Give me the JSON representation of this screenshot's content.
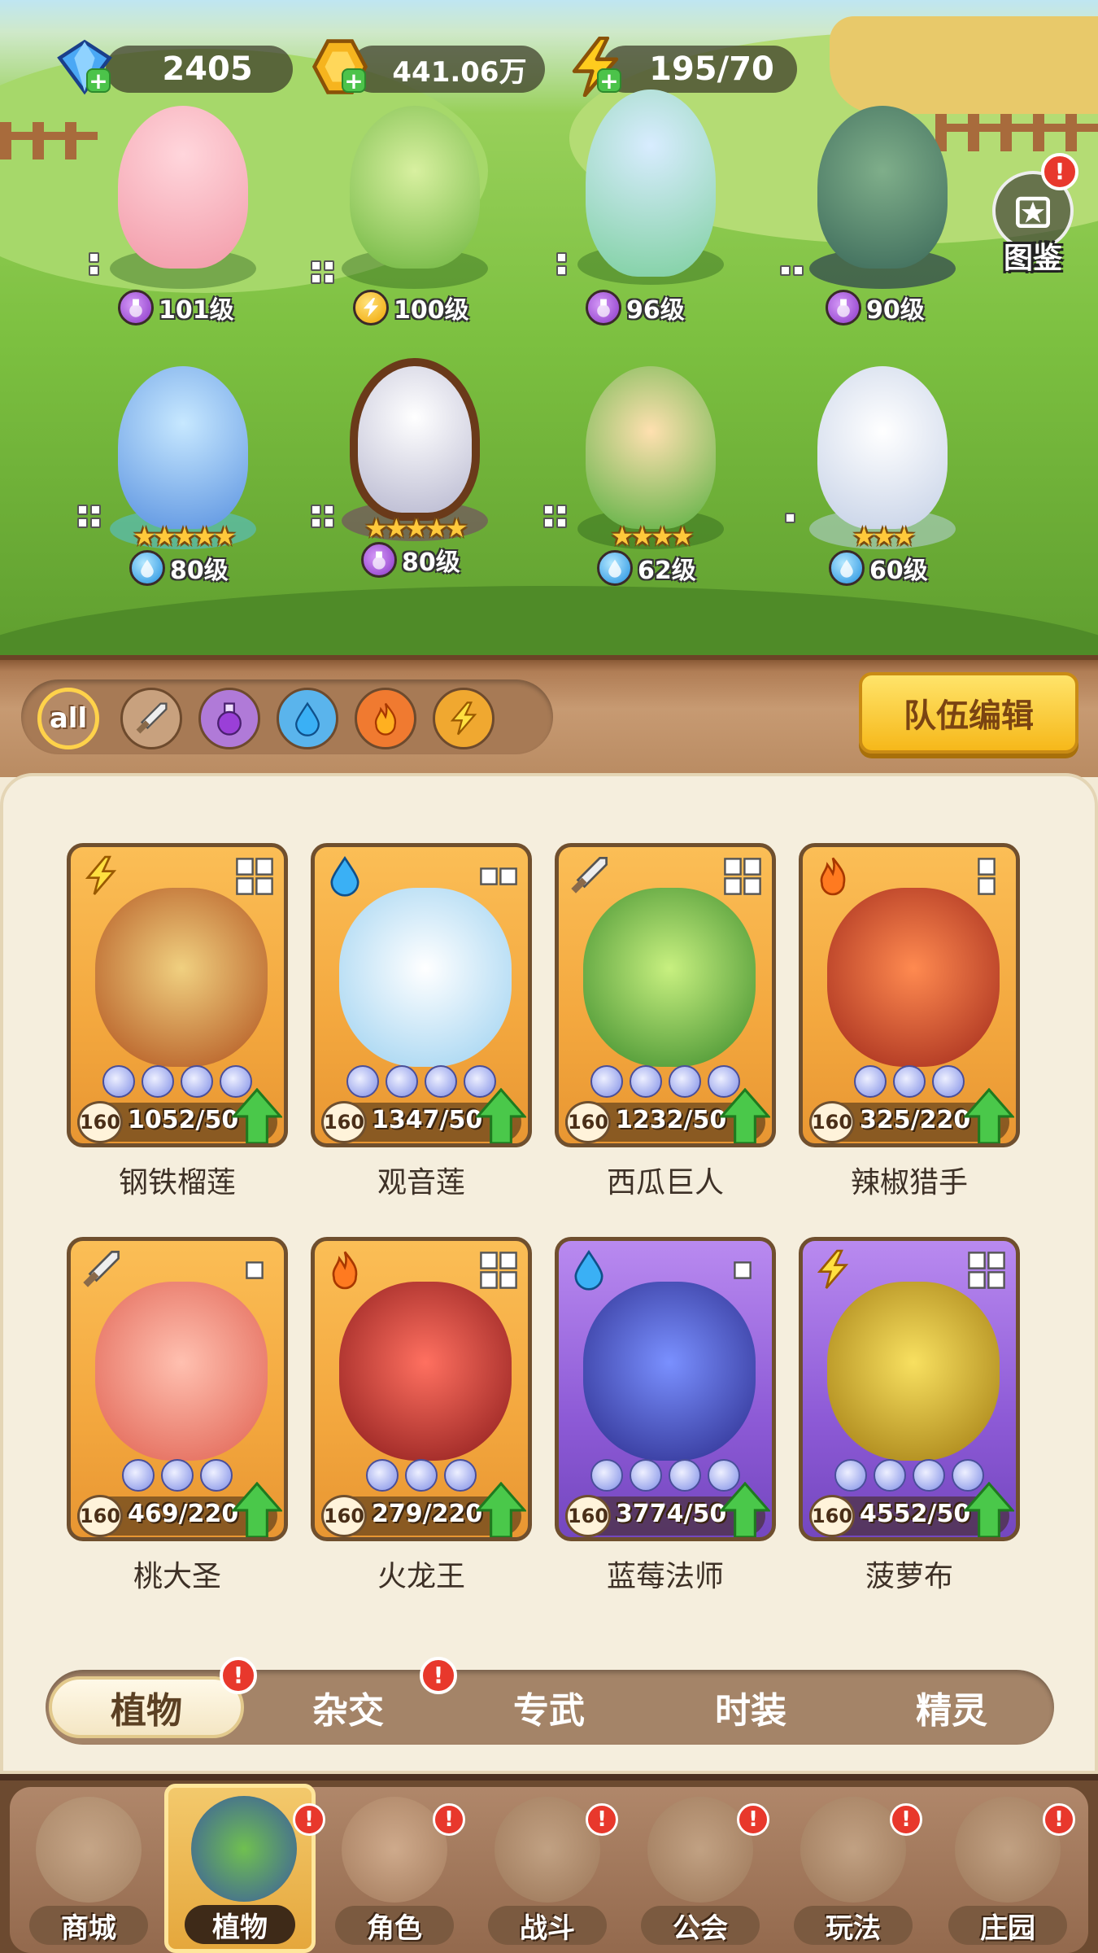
{
  "resources": {
    "gems": "2405",
    "gold": "441.06万",
    "energy": "195/70"
  },
  "atlas": {
    "label": "图鉴"
  },
  "lineup": [
    {
      "level": "101级",
      "element": "potion"
    },
    {
      "level": "100级",
      "element": "bolt"
    },
    {
      "level": "96级",
      "element": "potion"
    },
    {
      "level": "90级",
      "element": "potion"
    },
    {
      "level": "80级",
      "element": "water",
      "stars": "★★★★★"
    },
    {
      "level": "80级",
      "element": "potion",
      "stars": "★★★★★"
    },
    {
      "level": "62级",
      "element": "water",
      "stars": "★★★★"
    },
    {
      "level": "60级",
      "element": "water",
      "stars": "★★★"
    }
  ],
  "filters": {
    "all_label": "all",
    "icons": [
      "sword-icon",
      "potion-icon",
      "water-drop-icon",
      "fire-icon",
      "lightning-icon"
    ]
  },
  "team_edit_label": "队伍编辑",
  "cards": [
    {
      "name": "钢铁榴莲",
      "level": "160",
      "count": "1052/50",
      "element": "lightning",
      "rarity": "gold"
    },
    {
      "name": "观音莲",
      "level": "160",
      "count": "1347/50",
      "element": "water",
      "rarity": "gold"
    },
    {
      "name": "西瓜巨人",
      "level": "160",
      "count": "1232/50",
      "element": "sword",
      "rarity": "gold"
    },
    {
      "name": "辣椒猎手",
      "level": "160",
      "count": "325/220",
      "element": "fire",
      "rarity": "gold"
    },
    {
      "name": "桃大圣",
      "level": "160",
      "count": "469/220",
      "element": "sword",
      "rarity": "gold"
    },
    {
      "name": "火龙王",
      "level": "160",
      "count": "279/220",
      "element": "fire",
      "rarity": "gold"
    },
    {
      "name": "蓝莓法师",
      "level": "160",
      "count": "3774/50",
      "element": "water",
      "rarity": "purple"
    },
    {
      "name": "菠萝布",
      "level": "160",
      "count": "4552/50",
      "element": "lightning",
      "rarity": "purple"
    }
  ],
  "subtabs": [
    "植物",
    "杂交",
    "专武",
    "时装",
    "精灵"
  ],
  "nav": [
    "商城",
    "植物",
    "角色",
    "战斗",
    "公会",
    "玩法",
    "庄园"
  ],
  "alert_mark": "!",
  "colors": {
    "accent_gold": "#f6b81a",
    "card_gold": "#f3a73e",
    "card_purple": "#8d5ad6",
    "alert_red": "#e8382c"
  }
}
